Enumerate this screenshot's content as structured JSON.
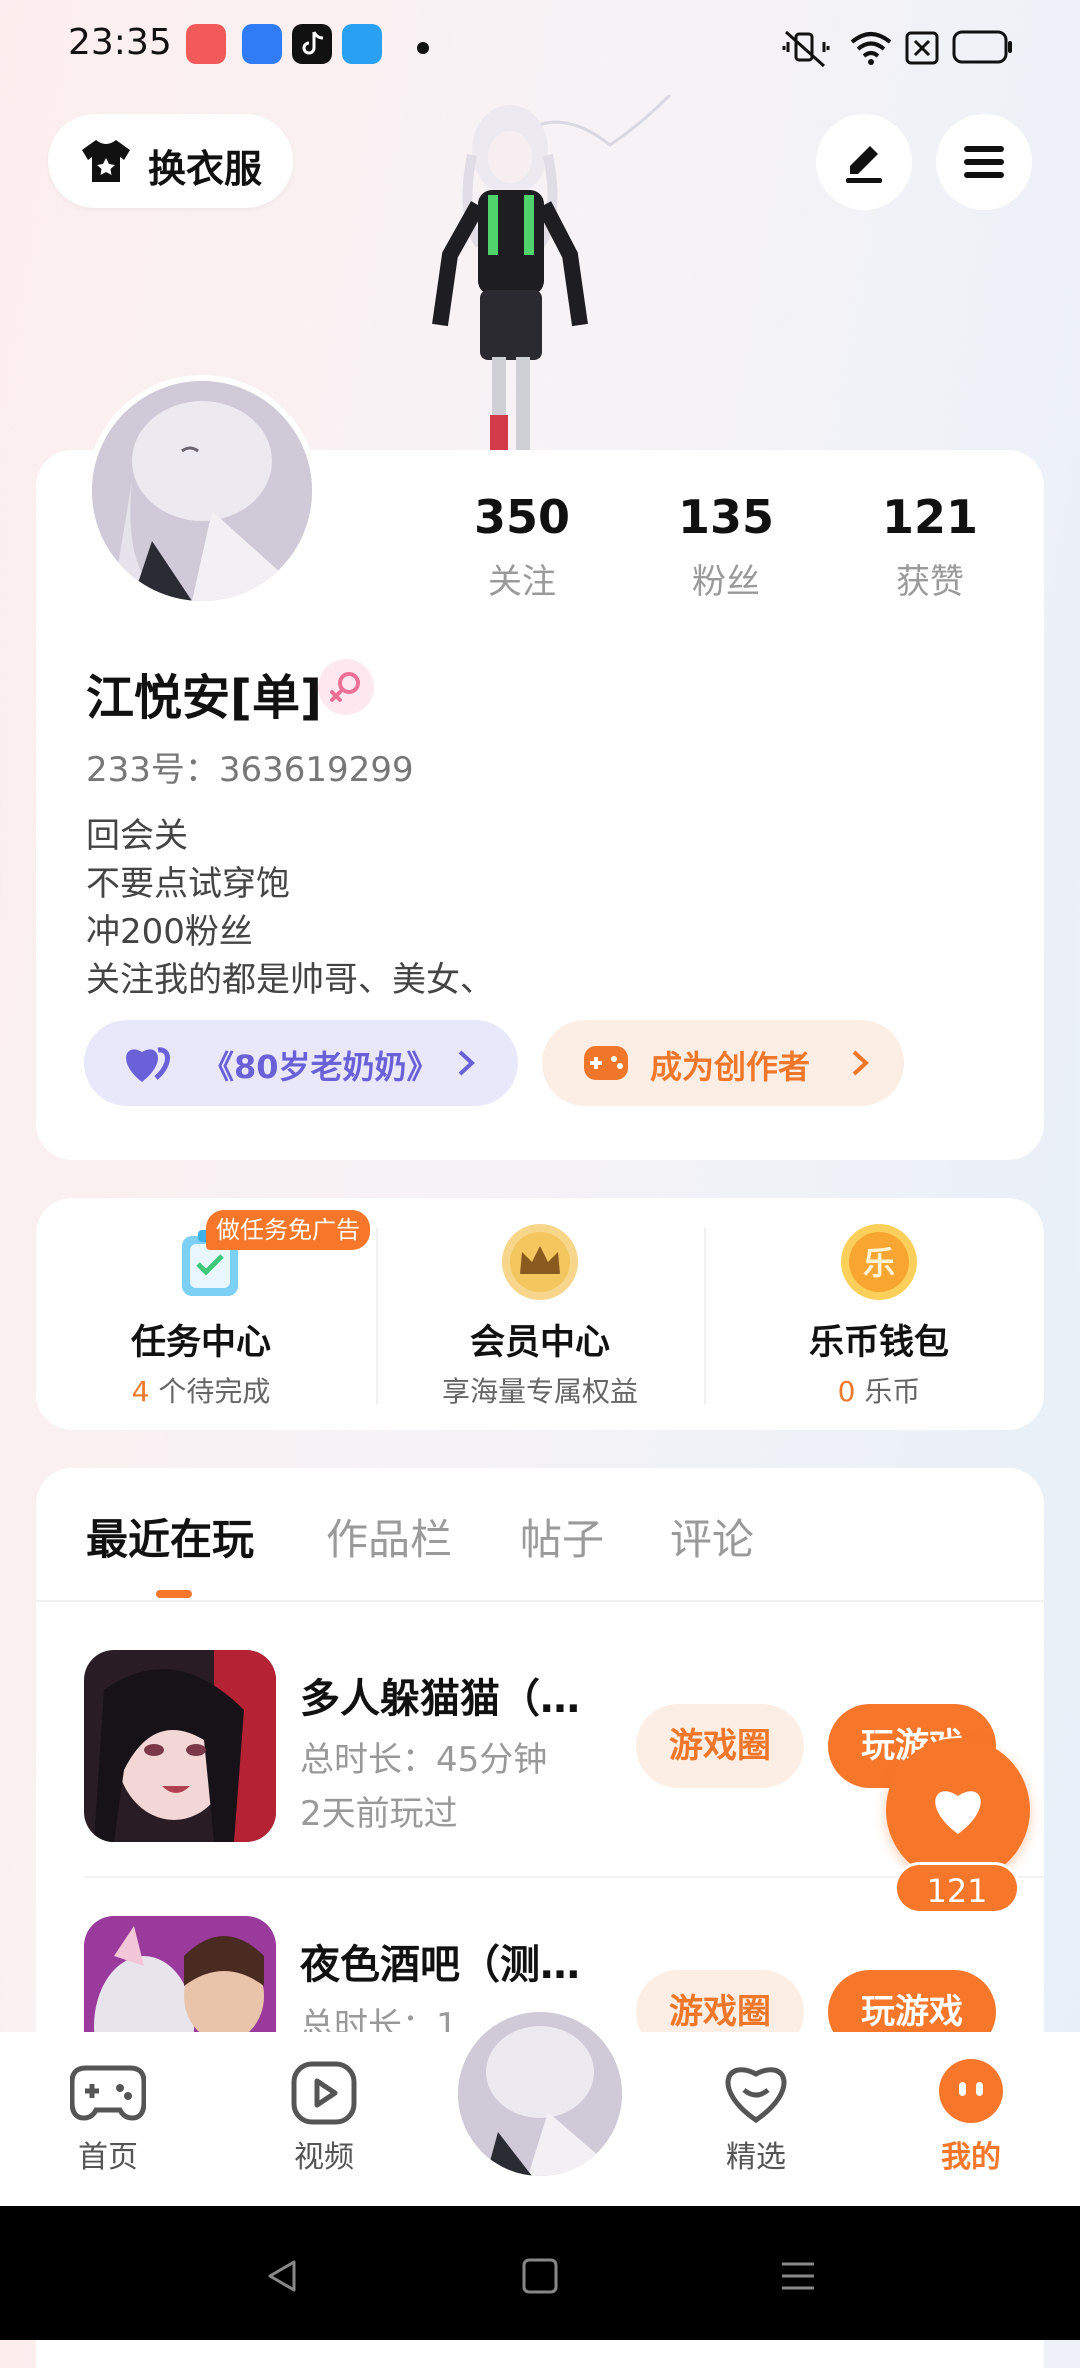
{
  "status_bar": {
    "time": "23:35",
    "apps": [
      "kuaishou-app-icon",
      "app-icon",
      "tiktok-app-icon",
      "app-icon"
    ],
    "icons": [
      "mute-vibrate-icon",
      "wifi-icon",
      "sim-off-icon",
      "battery-icon"
    ]
  },
  "header": {
    "dress_up_label": "换衣服",
    "edit_icon": "pen-icon",
    "menu_icon": "hamburger-menu-icon"
  },
  "profile": {
    "stats": [
      {
        "value": "350",
        "label": "关注"
      },
      {
        "value": "135",
        "label": "粉丝"
      },
      {
        "value": "121",
        "label": "获赞"
      }
    ],
    "username": "江悦安[单]",
    "user_id": "233号：363619299",
    "bio": [
      "回会关",
      "不要点试穿饱",
      "冲200粉丝",
      "关注我的都是帅哥、美女、"
    ],
    "featured_work": "《80岁老奶奶》",
    "creator_cta": "成为创作者"
  },
  "services": {
    "task_badge": "做任务免广告",
    "items": [
      {
        "title": "任务中心",
        "sub_num": "4",
        "sub_text": " 个待完成"
      },
      {
        "title": "会员中心",
        "sub_num": "",
        "sub_text": "享海量专属权益"
      },
      {
        "title": "乐币钱包",
        "sub_num": "0",
        "sub_text": " 乐币"
      }
    ],
    "coin_glyph": "乐"
  },
  "tabs": [
    "最近在玩",
    "作品栏",
    "帖子",
    "评论"
  ],
  "games": [
    {
      "title": "多人躲猫猫（…",
      "duration": "总时长：45分钟",
      "last_played": "2天前玩过",
      "circle_label": "游戏圈",
      "play_label": "玩游戏"
    },
    {
      "title": "夜色酒吧（测…",
      "duration": "总时长：1",
      "circle_label": "游戏圈",
      "play_label": "玩游戏"
    }
  ],
  "like_fab": {
    "count": "121"
  },
  "bottom_nav": [
    {
      "label": "首页"
    },
    {
      "label": "视频"
    },
    {
      "label": "精选"
    },
    {
      "label": "我的"
    }
  ],
  "colors": {
    "accent": "#f6762a",
    "purple": "#6a60d8",
    "chip_purple_bg": "#e9e8fb",
    "chip_orange_bg": "#fdeee5"
  }
}
